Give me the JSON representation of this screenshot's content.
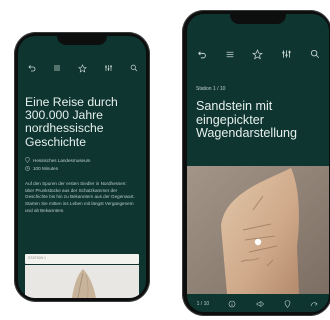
{
  "left": {
    "title": "Eine Reise durch 300.000 Jahre nordhessische Geschichte",
    "location": "Hessisches Landesmuseum",
    "duration": "100 Minuten",
    "description": "Auf den Spuren der ersten Siedler in Nordhessen: über Prunkstücke aus der Schatzkammer der Geschichte bis hin zu Bekanntem aus der Gegenwart. Starten Sie mitten ins Leben mit längst Vergangenem und alt Bekanntem.",
    "start_label": "STATION 1",
    "icons": [
      "undo-icon",
      "list-icon",
      "star-icon",
      "sliders-icon",
      "search-icon"
    ]
  },
  "right": {
    "station": "Station 1 / 10",
    "title": "Sandstein mit eingepickter Wagendarstellung",
    "counter": "1 / 10",
    "icons": [
      "undo-icon",
      "list-icon",
      "star-icon",
      "sliders-icon",
      "search-icon"
    ],
    "bottom_icons": [
      "info-icon",
      "audio-icon",
      "location-icon",
      "next-icon"
    ]
  },
  "colors": {
    "screen_bg": "#0e3530",
    "accent_text": "#e6efec"
  }
}
